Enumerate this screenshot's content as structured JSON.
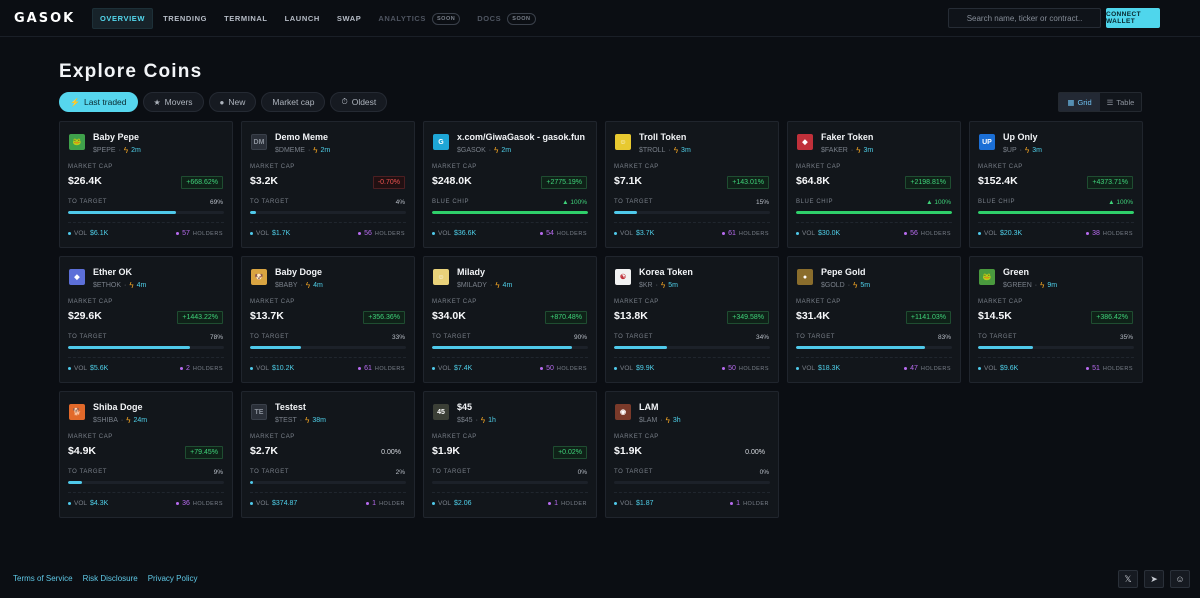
{
  "header": {
    "logo": "GASOK",
    "nav": [
      {
        "label": "OVERVIEW",
        "active": true
      },
      {
        "label": "TRENDING"
      },
      {
        "label": "TERMINAL"
      },
      {
        "label": "LAUNCH"
      },
      {
        "label": "SWAP"
      },
      {
        "label": "ANALYTICS",
        "badge": "SOON"
      },
      {
        "label": "DOCS",
        "badge": "SOON"
      }
    ],
    "search_placeholder": "Search name, ticker or contract..",
    "connect_label": "CONNECT WALLET"
  },
  "page_title": "Explore Coins",
  "filters": [
    {
      "label": "Last traded",
      "icon": "⚡",
      "active": true
    },
    {
      "label": "Movers",
      "icon": "★"
    },
    {
      "label": "New",
      "icon": "●"
    },
    {
      "label": "Market cap",
      "icon": ""
    },
    {
      "label": "Oldest",
      "icon": "⏱"
    }
  ],
  "view_toggle": {
    "grid": "Grid",
    "table": "Table"
  },
  "labels": {
    "market_cap": "MARKET CAP",
    "to_target": "TO TARGET",
    "blue_chip": "BLUE CHIP",
    "vol": "VOL",
    "holders": "HOLDERS",
    "holder": "HOLDER"
  },
  "coins": [
    {
      "name": "Baby Pepe",
      "ticker": "$PEPE",
      "age": "2m",
      "market_cap": "$26.4K",
      "change": "+668.62%",
      "dir": "up",
      "progress": 69,
      "progress_label": "69%",
      "volume": "$6.1K",
      "holders": "57",
      "avatar": "frog",
      "color": "#3fa14b"
    },
    {
      "name": "Demo Meme",
      "ticker": "$DMEME",
      "age": "2m",
      "market_cap": "$3.2K",
      "change": "-0.70%",
      "dir": "down",
      "progress": 4,
      "progress_label": "4%",
      "volume": "$1.7K",
      "holders": "56",
      "avatar": "DM",
      "color": "#2a2f38"
    },
    {
      "name": "x.com/GiwaGasok - gasok.fun",
      "ticker": "$GASOK",
      "age": "2m",
      "market_cap": "$248.0K",
      "change": "+2775.19%",
      "dir": "up",
      "progress": 100,
      "progress_label": "100%",
      "blue_chip": true,
      "volume": "$36.6K",
      "holders": "54",
      "avatar": "G",
      "color": "#1ea6d6"
    },
    {
      "name": "Troll Token",
      "ticker": "$TROLL",
      "age": "3m",
      "market_cap": "$7.1K",
      "change": "+143.01%",
      "dir": "up",
      "progress": 15,
      "progress_label": "15%",
      "volume": "$3.7K",
      "holders": "61",
      "avatar": "troll",
      "color": "#e8c930"
    },
    {
      "name": "Faker Token",
      "ticker": "$FAKER",
      "age": "3m",
      "market_cap": "$64.8K",
      "change": "+2198.81%",
      "dir": "up",
      "progress": 100,
      "progress_label": "100%",
      "blue_chip": true,
      "volume": "$30.0K",
      "holders": "56",
      "avatar": "faker",
      "color": "#c0303a"
    },
    {
      "name": "Up Only",
      "ticker": "$UP",
      "age": "3m",
      "market_cap": "$152.4K",
      "change": "+4373.71%",
      "dir": "up",
      "progress": 100,
      "progress_label": "100%",
      "blue_chip": true,
      "volume": "$20.3K",
      "holders": "38",
      "avatar": "UP",
      "color": "#1b6fd6"
    },
    {
      "name": "Ether OK",
      "ticker": "$ETHOK",
      "age": "4m",
      "market_cap": "$29.6K",
      "change": "+1443.22%",
      "dir": "up",
      "progress": 78,
      "progress_label": "78%",
      "volume": "$5.6K",
      "holders": "2",
      "avatar": "eth",
      "color": "#5c6fd8"
    },
    {
      "name": "Baby Doge",
      "ticker": "$BABY",
      "age": "4m",
      "market_cap": "$13.7K",
      "change": "+356.36%",
      "dir": "up",
      "progress": 33,
      "progress_label": "33%",
      "volume": "$10.2K",
      "holders": "61",
      "avatar": "doge",
      "color": "#d9a441"
    },
    {
      "name": "Milady",
      "ticker": "$MILADY",
      "age": "4m",
      "market_cap": "$34.0K",
      "change": "+870.48%",
      "dir": "up",
      "progress": 90,
      "progress_label": "90%",
      "volume": "$7.4K",
      "holders": "50",
      "avatar": "milady",
      "color": "#e9d27a"
    },
    {
      "name": "Korea Token",
      "ticker": "$KR",
      "age": "5m",
      "market_cap": "$13.8K",
      "change": "+349.58%",
      "dir": "up",
      "progress": 34,
      "progress_label": "34%",
      "volume": "$9.9K",
      "holders": "50",
      "avatar": "kr",
      "color": "#f2f2f2"
    },
    {
      "name": "Pepe Gold",
      "ticker": "$GOLD",
      "age": "5m",
      "market_cap": "$31.4K",
      "change": "+1141.03%",
      "dir": "up",
      "progress": 83,
      "progress_label": "83%",
      "volume": "$18.3K",
      "holders": "47",
      "avatar": "gold",
      "color": "#8a6d2c"
    },
    {
      "name": "Green",
      "ticker": "$GREEN",
      "age": "9m",
      "market_cap": "$14.5K",
      "change": "+386.42%",
      "dir": "up",
      "progress": 35,
      "progress_label": "35%",
      "volume": "$9.6K",
      "holders": "51",
      "avatar": "frog2",
      "color": "#4a9a3e"
    },
    {
      "name": "Shiba Doge",
      "ticker": "$SHIBA",
      "age": "24m",
      "market_cap": "$4.9K",
      "change": "+79.45%",
      "dir": "up",
      "progress": 9,
      "progress_label": "9%",
      "volume": "$4.3K",
      "holders": "36",
      "avatar": "shiba",
      "color": "#e2692a"
    },
    {
      "name": "Testest",
      "ticker": "$TEST",
      "age": "38m",
      "market_cap": "$2.7K",
      "change": "0.00%",
      "dir": "flat",
      "progress": 2,
      "progress_label": "2%",
      "volume": "$374.87",
      "holders": "1",
      "single": true,
      "avatar": "TE",
      "color": "#2a2f38"
    },
    {
      "name": "$45",
      "ticker": "$$45",
      "age": "1h",
      "market_cap": "$1.9K",
      "change": "+0.02%",
      "dir": "up",
      "progress": 0,
      "progress_label": "0%",
      "volume": "$2.06",
      "holders": "1",
      "single": true,
      "avatar": "45",
      "color": "#3b3f36"
    },
    {
      "name": "LAM",
      "ticker": "$LAM",
      "age": "3h",
      "market_cap": "$1.9K",
      "change": "0.00%",
      "dir": "flat",
      "progress": 0,
      "progress_label": "0%",
      "volume": "$1.87",
      "holders": "1",
      "single": true,
      "avatar": "lam",
      "color": "#7a3a2a"
    }
  ],
  "footer": {
    "links": [
      "Terms of Service",
      "Risk Disclosure",
      "Privacy Policy"
    ],
    "socials": [
      {
        "icon": "x-icon",
        "glyph": "𝕏"
      },
      {
        "icon": "telegram-icon",
        "glyph": "➤"
      },
      {
        "icon": "bot-icon",
        "glyph": "☺"
      }
    ]
  }
}
